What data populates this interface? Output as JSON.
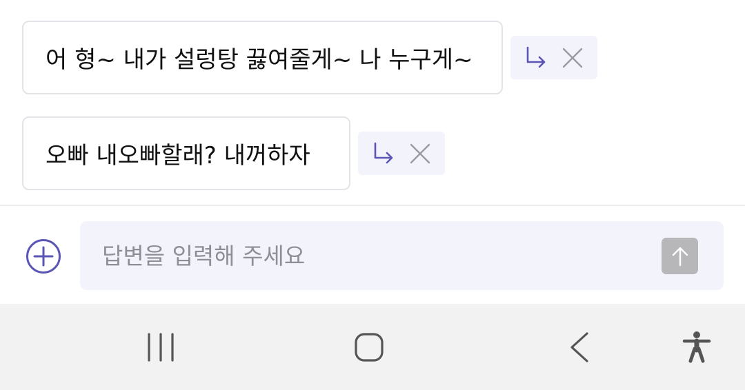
{
  "suggestions": [
    {
      "text": "어 형~ 내가 설렁탕 끓여줄게~ 나 누구게~",
      "actions": [
        "insert-arrow-icon",
        "close-icon"
      ]
    },
    {
      "text": "오빠 내오빠할래? 내꺼하자",
      "actions": [
        "insert-arrow-icon",
        "close-icon"
      ]
    }
  ],
  "composer": {
    "placeholder": "답변을 입력해 주세요",
    "value": "",
    "add_icon": "plus-circle-icon",
    "send_icon": "arrow-up-icon"
  },
  "navbar": {
    "buttons": [
      "recents-icon",
      "home-icon",
      "back-icon",
      "accessibility-icon"
    ]
  },
  "colors": {
    "accent": "#5b55b5",
    "action_bg": "#f3f3fc",
    "bubble_border": "#e4e4e8",
    "send_disabled": "#b7b7ba",
    "navbar_bg": "#f2f2f2",
    "placeholder": "#8e8e94"
  }
}
